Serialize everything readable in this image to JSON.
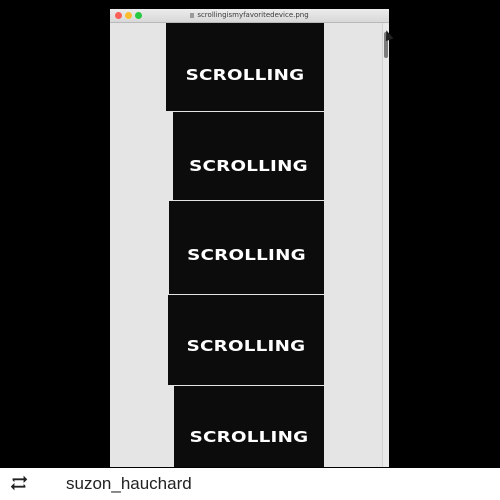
{
  "window": {
    "title": "scrollingismyfavoritedevice.png"
  },
  "frames": [
    {
      "text": "SCROLLING"
    },
    {
      "text": "SCROLLING"
    },
    {
      "text": "SCROLLING"
    },
    {
      "text": "SCROLLING"
    },
    {
      "text": "SCROLLING"
    }
  ],
  "repost": {
    "icon": "repost-icon",
    "username": "suzon_hauchard"
  },
  "colors": {
    "background": "#000000",
    "window": "#e5e5e5",
    "frame": "#0c0c0c",
    "text": "#ffffff",
    "close": "#fc5f57",
    "minimize": "#fdbc2e",
    "zoom": "#28c840"
  }
}
